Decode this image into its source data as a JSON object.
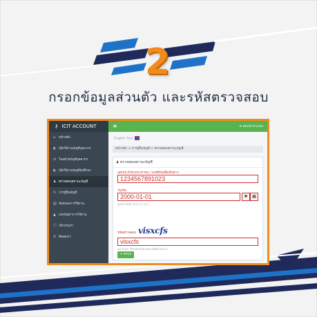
{
  "step": {
    "number": "2"
  },
  "headline": "กรอกข้อมูลส่วนตัว และรหัสตรวจสอบ",
  "colors": {
    "accent": "#f08b1d",
    "navy": "#1f2a5a",
    "blue": "#1e73c8",
    "green": "#58b351"
  },
  "app": {
    "brand": "ICIT ACCOUNT",
    "brand_icon": "user-key-icon",
    "menu_icon": "hamburger-icon",
    "logout": "ออกจากระบบ"
  },
  "sidebar": {
    "items": [
      {
        "icon": "home-icon",
        "label": "หน้าหลัก"
      },
      {
        "icon": "toggle-icon",
        "label": "เปิดใช้งานบัญชีบุคลากร"
      },
      {
        "icon": "shuffle-icon",
        "label": "โอนย้ายบัญชีบุคลากร"
      },
      {
        "icon": "toggle-icon",
        "label": "เปิดใช้งานบัญชีนักศึกษา"
      },
      {
        "icon": "user-icon",
        "label": "ตรวจสอบสถานะบัญชี"
      },
      {
        "icon": "refresh-icon",
        "label": "การกู้คืนบัญชี"
      },
      {
        "icon": "book-icon",
        "label": "ข้อตกลงการใช้งาน"
      },
      {
        "icon": "warning-icon",
        "label": "แจ้งปัญหาการใช้งาน"
      },
      {
        "icon": "info-icon",
        "label": "เกี่ยวกับเรา"
      },
      {
        "icon": "phone-icon",
        "label": "ติดต่อเรา"
      }
    ]
  },
  "content": {
    "language": "English  Thai",
    "breadcrumb": "หน้าหลัก  >  การกู้คืนบัญชี  >  ตรวจสอบสถานะบัญชี",
    "card_title": "ตรวจสอบสถานะบัญชี",
    "id_label": "เลขประจำตัวประชาชน / เลขที่หนังสือเดินทาง",
    "id_value": "1234567891023",
    "dob_label": "วันเกิด",
    "dob_value": "2000-01-01",
    "dob_help": "รูปแบบวันที่ (2010-12-31)",
    "captcha_label": "รหัสตรวจสอบ",
    "captcha_image_text": "visxcfs",
    "captcha_value": "visxcfs",
    "captcha_help": "หมายเหตุ: ให้กรอกตัวอักษรตามที่เห็นในภาพ",
    "clear_btn": "✖",
    "calendar_btn": "▦",
    "submit": "✔ ตรวจ"
  }
}
